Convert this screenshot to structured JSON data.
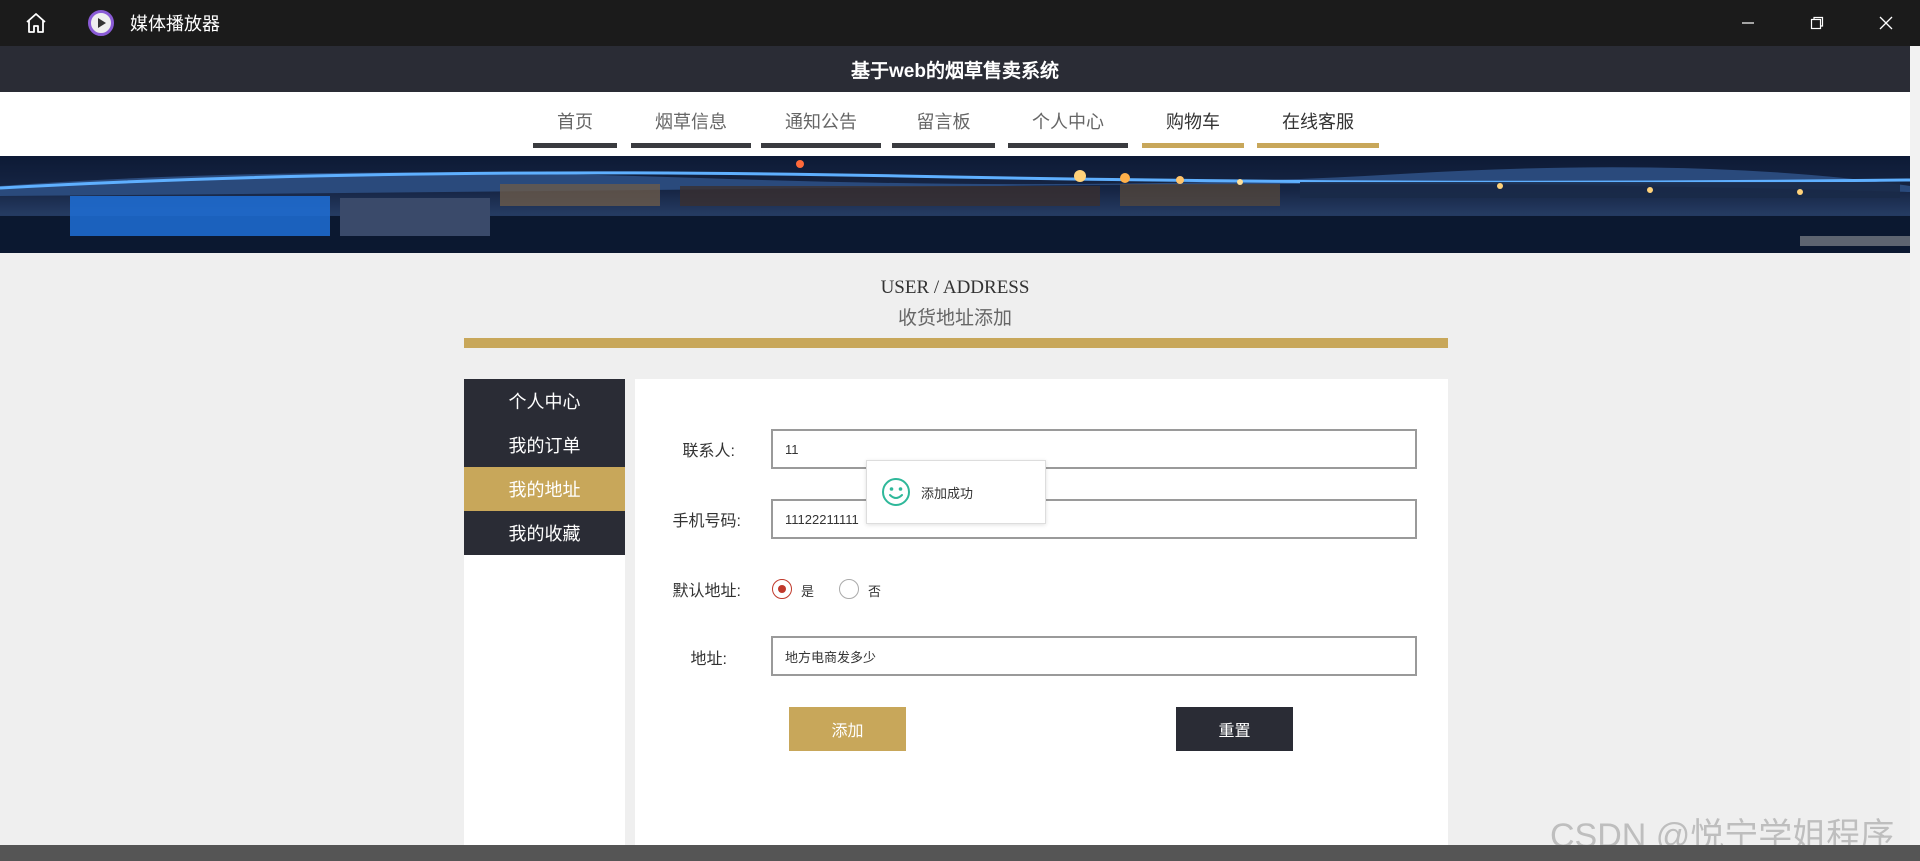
{
  "player": {
    "title": "媒体播放器",
    "icons": [
      "home-icon",
      "play-icon",
      "minimize-icon",
      "restore-icon",
      "close-icon"
    ]
  },
  "site": {
    "title": "基于web的烟草售卖系统"
  },
  "nav": {
    "items": [
      {
        "label": "首页"
      },
      {
        "label": "烟草信息"
      },
      {
        "label": "通知公告"
      },
      {
        "label": "留言板"
      },
      {
        "label": "个人中心"
      },
      {
        "label": "购物车"
      },
      {
        "label": "在线客服"
      }
    ]
  },
  "section": {
    "title_en": "USER / ADDRESS",
    "title_zh": "收货地址添加"
  },
  "sidebar": {
    "items": [
      {
        "label": "个人中心",
        "active": false
      },
      {
        "label": "我的订单",
        "active": false
      },
      {
        "label": "我的地址",
        "active": true
      },
      {
        "label": "我的收藏",
        "active": false
      }
    ]
  },
  "form": {
    "contact_label": "联系人:",
    "contact_value": "11",
    "phone_label": "手机号码:",
    "phone_value": "11122211111",
    "default_label": "默认地址:",
    "default_options": {
      "yes": "是",
      "no": "否"
    },
    "default_selected": "是",
    "address_label": "地址:",
    "address_value": "地方电商发多少",
    "submit_label": "添加",
    "reset_label": "重置"
  },
  "toast": {
    "message": "添加成功",
    "icon": "smile-icon"
  },
  "watermark": "CSDN @悦宁学姐程序",
  "colors": {
    "gold": "#c8a75a",
    "dark": "#2a2c35",
    "radio_red": "#c0392b"
  }
}
